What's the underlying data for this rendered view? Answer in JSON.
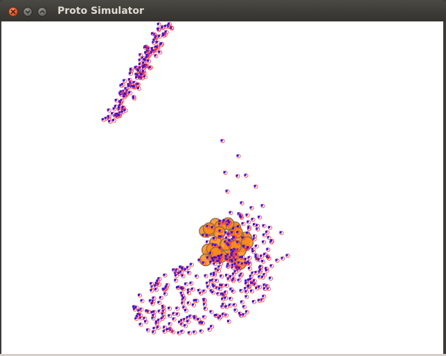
{
  "window": {
    "title": "Proto Simulator"
  },
  "titlebar_buttons": {
    "close_icon": "close-icon",
    "minimize_icon": "chevron-down-icon",
    "maximize_icon": "chevron-up-icon"
  },
  "simulation": {
    "colors": {
      "device_dot": "#3a14d8",
      "device_ring": "#ff4040",
      "active_fill": "#ff8c1a",
      "active_ring": "#8a6a4a",
      "background": "#ffffff"
    }
  }
}
